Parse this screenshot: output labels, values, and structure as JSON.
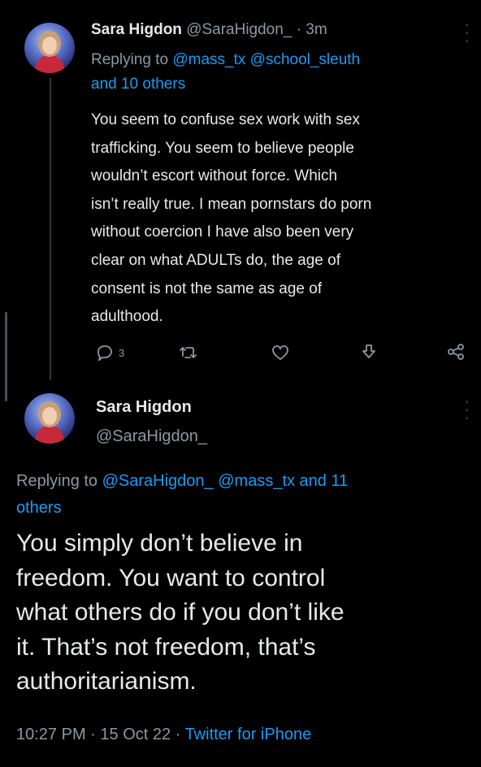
{
  "tweet1": {
    "display_name": "Sara Higdon",
    "handle": "@SaraHigdon_",
    "time": "· 3m",
    "replying_prefix": "Replying to",
    "replying_users": "@mass_tx @school_sleuth",
    "replying_others": "and 10 others",
    "text_lines": [
      "You seem to confuse sex work with sex",
      "trafficking. You seem to believe people",
      "wouldn’t escort without force. Which",
      "isn’t really true. I mean pornstars do porn",
      "without coercion I have also been very",
      "clear on what ADULTs do, the age of",
      "consent is not the same as age of",
      "adulthood."
    ],
    "reply_count": "3"
  },
  "tweet2": {
    "display_name": "Sara Higdon",
    "handle": "@SaraHigdon_",
    "replying_prefix": "Replying to",
    "replying_users": "@SaraHigdon_ @mass_tx and 11",
    "replying_others": "others",
    "text_lines": [
      "You simply don’t believe in",
      "freedom. You want to control",
      "what others do if you don’t like",
      "it. That’s not freedom, that’s",
      "authoritarianism."
    ],
    "time": "10:27 PM",
    "date": "15 Oct 22",
    "source": "Twitter for iPhone",
    "separator": "·"
  },
  "icons": [
    "reply-icon",
    "retweet-icon",
    "like-icon",
    "download-icon",
    "share-icon",
    "more-icon"
  ],
  "colors": {
    "background": "#000000",
    "link": "#1d9bf0",
    "muted": "#8b98a5",
    "text": "#e7e9ea"
  }
}
